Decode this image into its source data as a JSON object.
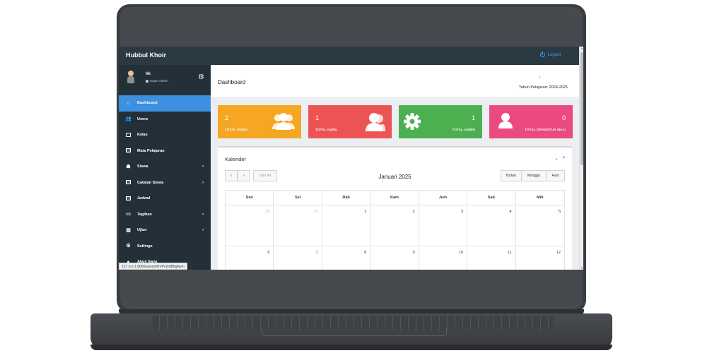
{
  "app": {
    "brand": "Hubbul Khoir",
    "logout_label": "Logout"
  },
  "user": {
    "name": "hk",
    "role": "Super Admin"
  },
  "sidebar": {
    "items": [
      {
        "label": "Dashboard",
        "icon": "home-icon",
        "active": true
      },
      {
        "label": "Users",
        "icon": "users-icon"
      },
      {
        "label": "Kelas",
        "icon": "copy-icon"
      },
      {
        "label": "Mata Pelajaran",
        "icon": "book-icon"
      },
      {
        "label": "Siswa",
        "icon": "user-graduate-icon",
        "chevron": "›"
      },
      {
        "label": "Catatan Siswa",
        "icon": "table-icon",
        "chevron": "›"
      },
      {
        "label": "Jadwal",
        "icon": "calendar-icon"
      },
      {
        "label": "Tagihan",
        "icon": "money-icon",
        "chevron": "›"
      },
      {
        "label": "Ujian",
        "icon": "books-icon",
        "chevron": "›"
      },
      {
        "label": "Settings",
        "icon": "gear-icon"
      },
      {
        "label": "Akun Saya",
        "icon": "user-icon"
      }
    ]
  },
  "status_url": "127.0.0.1:8000/users/rKVPv2nBBqjNvm",
  "header": {
    "title": "Dashboard",
    "academic_year": "Tahun Pelajaran: 2024-2025"
  },
  "cards": [
    {
      "value": "2",
      "label": "TOTAL SISWA",
      "color": "#f5a623",
      "icon": "users-icon"
    },
    {
      "value": "1",
      "label": "TOTAL GURU",
      "color": "#ec5454",
      "icon": "user-tie-icon"
    },
    {
      "value": "1",
      "label": "TOTAL ADMIN",
      "color": "#4cb050",
      "icon": "gear-icon"
    },
    {
      "value": "0",
      "label": "TOTAL ORANGTUA WALI",
      "color": "#ea4a7f",
      "icon": "user-icon"
    }
  ],
  "calendar": {
    "title": "Kalender",
    "collapse_icon": "⌄",
    "close_icon": "×",
    "today_label": "hari ini",
    "month": "Januari 2025",
    "views": [
      "Bulan",
      "Minggu",
      "Hari"
    ],
    "days": [
      "Sen",
      "Sel",
      "Rab",
      "Kam",
      "Jum",
      "Sab",
      "Min"
    ],
    "weeks": [
      [
        "30",
        "31",
        "1",
        "2",
        "3",
        "4",
        "5"
      ],
      [
        "6",
        "7",
        "8",
        "9",
        "10",
        "11",
        "12"
      ]
    ]
  }
}
